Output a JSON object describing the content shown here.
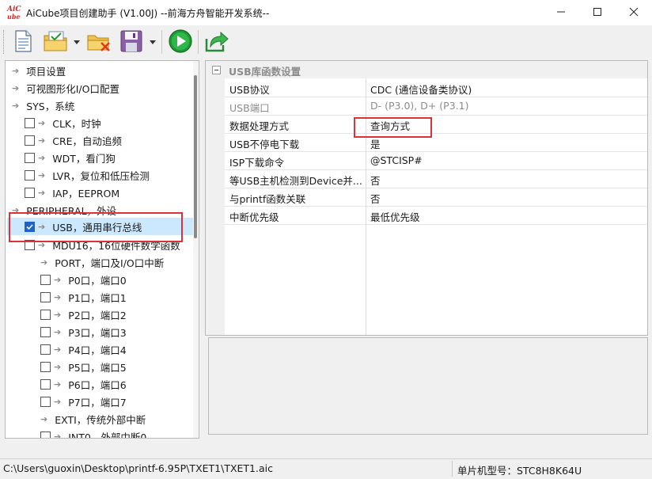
{
  "window": {
    "logo_text": "AiCube",
    "title": "AiCube项目创建助手 (V1.00J) --前海方舟智能开发系统--",
    "minimize_icon": "minimize-icon",
    "maximize_icon": "maximize-icon",
    "close_icon": "close-icon"
  },
  "toolbar": {
    "buttons": [
      "new-document-icon",
      "open-project-icon",
      "delete-project-icon",
      "save-icon",
      "run-icon",
      "export-icon"
    ]
  },
  "tree": {
    "items": [
      {
        "label": "项目设置",
        "checkbox": false,
        "checked": false
      },
      {
        "label": "可视图形化I/O口配置",
        "checkbox": false,
        "checked": false
      },
      {
        "label": "SYS，系统",
        "checkbox": false,
        "checked": false
      },
      {
        "label": "CLK，时钟",
        "checkbox": true,
        "checked": false
      },
      {
        "label": "CRE，自动追频",
        "checkbox": true,
        "checked": false
      },
      {
        "label": "WDT，看门狗",
        "checkbox": true,
        "checked": false
      },
      {
        "label": "LVR，复位和低压检测",
        "checkbox": true,
        "checked": false
      },
      {
        "label": "IAP，EEPROM",
        "checkbox": true,
        "checked": false
      },
      {
        "label": "PERIPHERAL，外设",
        "checkbox": false,
        "checked": false
      },
      {
        "label": "USB，通用串行总线",
        "checkbox": true,
        "checked": true
      },
      {
        "label": "MDU16，16位硬件数学函数",
        "checkbox": true,
        "checked": false
      },
      {
        "label": "PORT，端口及I/O口中断",
        "checkbox": false,
        "checked": false
      },
      {
        "label": "P0口，端口0",
        "checkbox": true,
        "checked": false
      },
      {
        "label": "P1口，端口1",
        "checkbox": true,
        "checked": false
      },
      {
        "label": "P2口，端口2",
        "checkbox": true,
        "checked": false
      },
      {
        "label": "P3口，端口3",
        "checkbox": true,
        "checked": false
      },
      {
        "label": "P4口，端口4",
        "checkbox": true,
        "checked": false
      },
      {
        "label": "P5口，端口5",
        "checkbox": true,
        "checked": false
      },
      {
        "label": "P6口，端口6",
        "checkbox": true,
        "checked": false
      },
      {
        "label": "P7口，端口7",
        "checkbox": true,
        "checked": false
      },
      {
        "label": "EXTI，传统外部中断",
        "checkbox": false,
        "checked": false
      },
      {
        "label": "INT0，外部中断0",
        "checkbox": true,
        "checked": false
      }
    ]
  },
  "properties": {
    "group_label": "USB库函数设置",
    "collapse_icon": "collapse-icon",
    "rows": [
      {
        "name": "USB协议",
        "value": "CDC (通信设备类协议)",
        "disabled": false
      },
      {
        "name": "USB端口",
        "value": "D- (P3.0), D+ (P3.1)",
        "disabled": true
      },
      {
        "name": "数据处理方式",
        "value": "查询方式",
        "disabled": false
      },
      {
        "name": "USB不停电下载",
        "value": "是",
        "disabled": false
      },
      {
        "name": "ISP下载命令",
        "value": "@STCISP#",
        "disabled": false
      },
      {
        "name": "等USB主机检测到Device并...",
        "value": "否",
        "disabled": false
      },
      {
        "name": "与printf函数关联",
        "value": "否",
        "disabled": false
      },
      {
        "name": "中断优先级",
        "value": "最低优先级",
        "disabled": false
      }
    ]
  },
  "status": {
    "path": "C:\\Users\\guoxin\\Desktop\\printf-6.95P\\TXET1\\TXET1.aic",
    "model": "单片机型号：STC8H8K64U"
  },
  "colors": {
    "highlight_box": "#d9323a",
    "selection": "#cce8ff",
    "checkbox_checked": "#1e63c9"
  }
}
